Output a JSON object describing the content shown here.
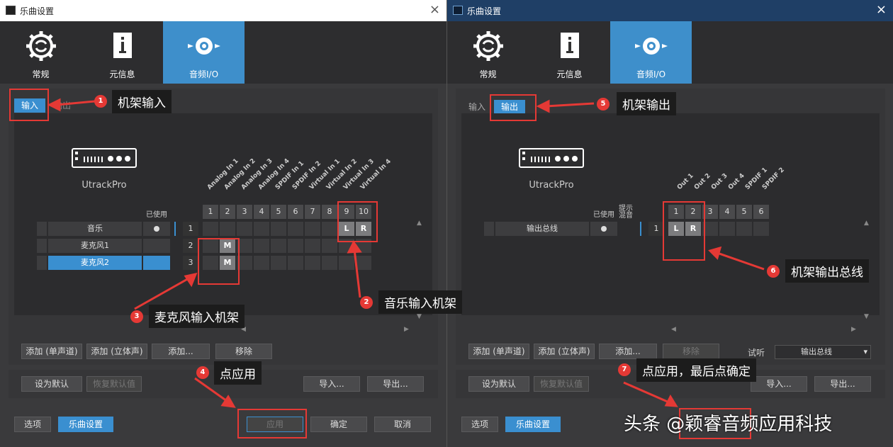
{
  "left": {
    "title": "乐曲设置",
    "tabs": [
      {
        "label": "常规"
      },
      {
        "label": "元信息"
      },
      {
        "label": "音频I/O"
      }
    ],
    "subtabs": {
      "input": "输入",
      "output": "输出"
    },
    "device_name": "UtrackPro",
    "used_label": "已使用",
    "columns": [
      "Analog In 1",
      "Analog In 2",
      "Analog In 3",
      "Analog In 4",
      "SPDIF In 1",
      "SPDIF In 2",
      "Virtual In 1",
      "Virtual In 2",
      "Virtual In 3",
      "Virtual In 4"
    ],
    "col_nums": [
      "1",
      "2",
      "3",
      "4",
      "5",
      "6",
      "7",
      "8",
      "9",
      "10"
    ],
    "rows": [
      {
        "name": "音乐",
        "num": "1"
      },
      {
        "name": "麦克风1",
        "num": "2"
      },
      {
        "name": "麦克风2",
        "num": "3"
      }
    ],
    "marks": {
      "r1c9": "L",
      "r1c10": "R",
      "r2c2": "M",
      "r3c2": "M"
    },
    "buttons": {
      "add_mono": "添加 (单声道)",
      "add_stereo": "添加 (立体声)",
      "add": "添加...",
      "remove": "移除",
      "set_default": "设为默认",
      "restore_default": "恢复默认值",
      "import": "导入...",
      "export": "导出...",
      "options": "选项",
      "song_settings": "乐曲设置",
      "apply": "应用",
      "ok": "确定",
      "cancel": "取消"
    }
  },
  "right": {
    "title": "乐曲设置",
    "tabs": [
      {
        "label": "常规"
      },
      {
        "label": "元信息"
      },
      {
        "label": "音频I/O"
      }
    ],
    "subtabs": {
      "input": "输入",
      "output": "输出"
    },
    "device_name": "UtrackPro",
    "used_label": "已使用",
    "cue_label": "提示\n混音",
    "columns": [
      "Out 1",
      "Out 2",
      "Out 3",
      "Out 4",
      "SPDIF 1",
      "SPDIF 2"
    ],
    "col_nums": [
      "1",
      "2",
      "3",
      "4",
      "5",
      "6"
    ],
    "rows": [
      {
        "name": "输出总线",
        "num": "1"
      }
    ],
    "marks": {
      "r1c1": "L",
      "r1c2": "R"
    },
    "audition_label": "试听",
    "audition_value": "输出总线",
    "buttons": {
      "add_mono": "添加 (单声道)",
      "add_stereo": "添加 (立体声)",
      "add": "添加...",
      "remove": "移除",
      "set_default": "设为默认",
      "restore_default": "恢复默认值",
      "import": "导入...",
      "export": "导出...",
      "options": "选项",
      "song_settings": "乐曲设置"
    }
  },
  "annotations": [
    {
      "num": "1",
      "text": "机架输入"
    },
    {
      "num": "2",
      "text": "音乐输入机架"
    },
    {
      "num": "3",
      "text": "麦克风输入机架"
    },
    {
      "num": "4",
      "text": "点应用"
    },
    {
      "num": "5",
      "text": "机架输出"
    },
    {
      "num": "6",
      "text": "机架输出总线"
    },
    {
      "num": "7",
      "text": "点应用，最后点确定"
    }
  ],
  "watermark": "头条 @颖睿音频应用科技",
  "colors": {
    "accent": "#3a8fd0",
    "annotation_red": "#e53935",
    "window_bg": "#3a3a3c"
  }
}
